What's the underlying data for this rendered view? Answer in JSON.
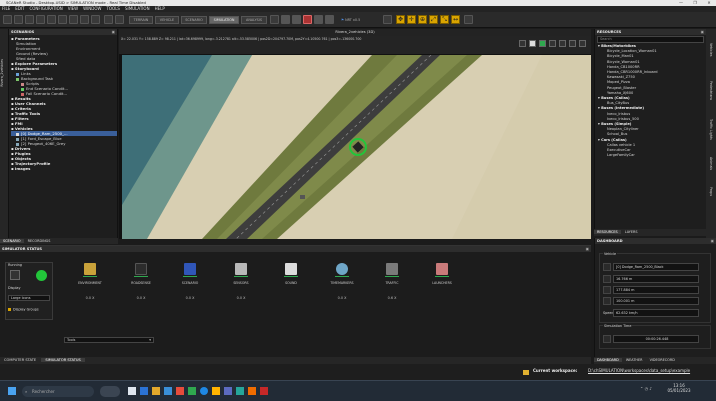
{
  "window": {
    "title": "SCANeR Studio - Desktop-USID > SIMULATION mode - Real Time Disabled",
    "controls": [
      "—",
      "❐",
      "✕"
    ]
  },
  "menu": [
    "FILE",
    "EDIT",
    "CONFIGURATION",
    "VIEW",
    "WINDOW",
    "TOOLS",
    "SIMULATION",
    "HELP"
  ],
  "toolbar": {
    "mode_tabs": [
      "TERRAIN",
      "VEHICLE",
      "SCENARIO",
      "SIMULATION",
      "ANALYSIS"
    ],
    "active_mode": "SIMULATION",
    "speed_label": "NRT x0.5"
  },
  "scenarios": {
    "header": "SCENARIOS",
    "sidebar_tab": "Rivera_2vehicles",
    "items": [
      {
        "label": "Parameters",
        "level": 0,
        "bold": true
      },
      {
        "label": "Simulation",
        "level": 1
      },
      {
        "label": "Environment",
        "level": 1
      },
      {
        "label": "Ground (Review)",
        "level": 1
      },
      {
        "label": "Sfied data",
        "level": 1
      },
      {
        "label": "Explore Parameters",
        "level": 0,
        "bold": true
      },
      {
        "label": "Storyboard",
        "level": 0,
        "bold": true
      },
      {
        "label": "Links",
        "level": 1
      },
      {
        "label": "Background Task",
        "level": 1
      },
      {
        "label": "Scripts",
        "level": 2
      },
      {
        "label": "End Scenario Condit...",
        "level": 2
      },
      {
        "label": "Fail Scenario Condit...",
        "level": 2
      },
      {
        "label": "Results",
        "level": 0,
        "bold": true
      },
      {
        "label": "User Channels",
        "level": 0,
        "bold": true
      },
      {
        "label": "Criteria",
        "level": 0,
        "bold": true
      },
      {
        "label": "Traffic Tools",
        "level": 0,
        "bold": true
      },
      {
        "label": "Filters",
        "level": 0,
        "bold": true
      },
      {
        "label": "FMI",
        "level": 0,
        "bold": true
      },
      {
        "label": "Vehicles",
        "level": 0,
        "bold": true
      },
      {
        "label": "[0] Dodge_Ram_2500_...",
        "level": 1,
        "selected": true
      },
      {
        "label": "[1] Ford_Escape_Blue",
        "level": 1
      },
      {
        "label": "[2] Peugeot_406E_Grey",
        "level": 1
      },
      {
        "label": "Drivers",
        "level": 0,
        "bold": true
      },
      {
        "label": "Plugins",
        "level": 0,
        "bold": true
      },
      {
        "label": "Objects",
        "level": 0,
        "bold": true
      },
      {
        "label": "TrajectoryProfile",
        "level": 0,
        "bold": true
      },
      {
        "label": "Images",
        "level": 0,
        "bold": true
      }
    ],
    "tabs": [
      "SCENARIO",
      "RECORDINGS"
    ]
  },
  "viewport": {
    "title": "Rivera_2vehicles (3D)",
    "coords": "X= 22.031  Y= 158.889  Z= 98.211  | lat=36.698999, long=-3.212781 alt=-53.585006 | pos2D=204797.70M, pos2Y=4.10500.761 | pos3=-136000.700"
  },
  "resources": {
    "header": "RESOURCES",
    "search_placeholder": "Search",
    "groups": [
      {
        "label": "Bikes/Motorbikes",
        "items": [
          "Bicycle_Location_Woman01",
          "Bicycle_Man01",
          "Bicycle_Woman01",
          "Honda_CB1000RR",
          "Honda_CBR1000RR_Inboard",
          "Kawasaki_Z750",
          "Moped_Pizza",
          "Peugeot_Blaster",
          "Yamaha_XJ600"
        ]
      },
      {
        "label": "Buses (Callas)",
        "items": [
          "Bus_CityBus"
        ]
      },
      {
        "label": "Buses (Intermediate)",
        "items": [
          "Iveco_Irisbus",
          "Iveco_Irisbus_500"
        ]
      },
      {
        "label": "Buses (Simple)",
        "items": [
          "Neoplan_Cityliner",
          "School_Bus"
        ]
      },
      {
        "label": "Cars (Callas)",
        "items": [
          "Callas vehicle 1",
          "ExecutiveCar",
          "LargeFamilyCar"
        ]
      }
    ],
    "tabs": [
      "RESOURCES",
      "LAYERS"
    ],
    "side_tabs": [
      "Vehicles",
      "Pedestrians",
      "Traffic Lights",
      "Animals",
      "Props"
    ]
  },
  "sim_status": {
    "header": "SIMULATOR STATUS",
    "running_label": "Running",
    "display_label": "Display",
    "display_select": "Large Icons",
    "display_groups_label": "Display Groups",
    "modules": [
      {
        "name": "ENVIRONMENT",
        "value": "0.0 X",
        "color": "#c9a23a"
      },
      {
        "name": "ROADSENSE",
        "value": "0.0 X",
        "color": "#2c2c2c"
      },
      {
        "name": "SCENARIO",
        "value": "0.0 X",
        "color": "#3056b8"
      },
      {
        "name": "SENSORS",
        "value": "0.0 X",
        "color": "#b8b8b8"
      },
      {
        "name": "SOUND",
        "value": "",
        "color": "#dcdcdc"
      },
      {
        "name": "TIMEMARKERS",
        "value": "0.0 X",
        "color": "#6fa6c7"
      },
      {
        "name": "TRAFFIC",
        "value": "0.6 X",
        "color": "#7a7a7a"
      },
      {
        "name": "LAUNCHERS",
        "value": "",
        "color": "#c97a7a"
      }
    ],
    "tools_select": "Tools",
    "bottom_tabs": [
      "COMPUTER STATE",
      "SIMULATOR STATUS"
    ],
    "active_bottom_tab": "SIMULATOR STATUS"
  },
  "dashboard": {
    "header": "DASHBOARD",
    "vehicle_label": "Vehicle",
    "vehicle": "[0] Dodge_Ram_2500_Black",
    "x": "16.766 m",
    "y": "177.884 m",
    "z": "100.001 m",
    "speed_label": "Speed",
    "speed": "62.632 km/h",
    "sim_time_label": "Simulation Time",
    "sim_time": "00:00:26.448",
    "tabs": [
      "DASHBOARD",
      "WEATHER",
      "VIDEORECORD"
    ],
    "active_tab": "DASHBOARD"
  },
  "workspace": {
    "label": "Current workspace:",
    "path": "D:\\chSIMULATION\\workspaces\\data_setup\\example"
  },
  "taskbar": {
    "search_placeholder": "Rechercher",
    "time": "13:16",
    "date": "05/01/2023"
  },
  "colors": {
    "accent": "#3a5f9a",
    "yellow": "#d9a400",
    "green_ring": "#22c53a",
    "road": "#3a3a3a"
  }
}
